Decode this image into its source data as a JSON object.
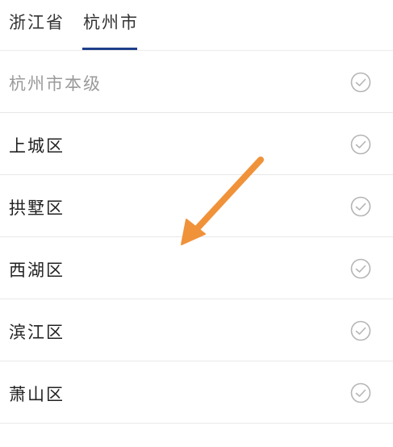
{
  "tabs": [
    {
      "label": "浙江省"
    },
    {
      "label": "杭州市"
    }
  ],
  "rows": [
    {
      "label": "杭州市本级",
      "disabled": true
    },
    {
      "label": "上城区",
      "disabled": false
    },
    {
      "label": "拱墅区",
      "disabled": false
    },
    {
      "label": "西湖区",
      "disabled": false
    },
    {
      "label": "滨江区",
      "disabled": false
    },
    {
      "label": "萧山区",
      "disabled": false
    }
  ],
  "colors": {
    "active_tab_underline": "#1f3f8a",
    "arrow": "#f0923a",
    "check": "#b5b5b5"
  }
}
